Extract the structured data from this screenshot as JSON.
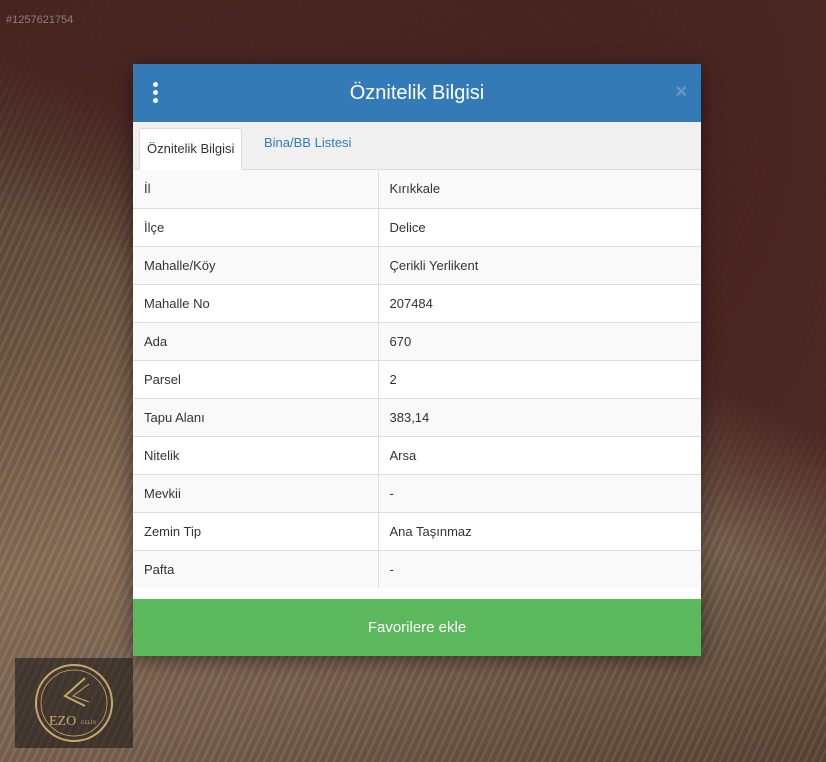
{
  "background": {
    "watermark_id": "#1257621754",
    "logo_text": "EZO",
    "logo_subtext": "GELİN"
  },
  "dialog": {
    "title": "Öznitelik Bilgisi",
    "menu_icon": "vertical-ellipsis-icon",
    "close_icon": "close-icon",
    "close_label": "×",
    "tabs": [
      {
        "label": "Öznitelik Bilgisi",
        "active": true
      },
      {
        "label": "Bina/BB Listesi",
        "active": false
      }
    ],
    "rows": [
      {
        "key": "İl",
        "value": "Kırıkkale"
      },
      {
        "key": "İlçe",
        "value": "Delice"
      },
      {
        "key": "Mahalle/Köy",
        "value": "Çerikli Yerlikent"
      },
      {
        "key": "Mahalle No",
        "value": "207484"
      },
      {
        "key": "Ada",
        "value": "670"
      },
      {
        "key": "Parsel",
        "value": "2"
      },
      {
        "key": "Tapu Alanı",
        "value": "383,14"
      },
      {
        "key": "Nitelik",
        "value": "Arsa"
      },
      {
        "key": "Mevkii",
        "value": "-"
      },
      {
        "key": "Zemin Tip",
        "value": "Ana Taşınmaz"
      },
      {
        "key": "Pafta",
        "value": "-"
      }
    ],
    "favorite_button": "Favorilere ekle"
  },
  "colors": {
    "header": "#337ab7",
    "button": "#5cb85c",
    "link": "#337ab7"
  }
}
